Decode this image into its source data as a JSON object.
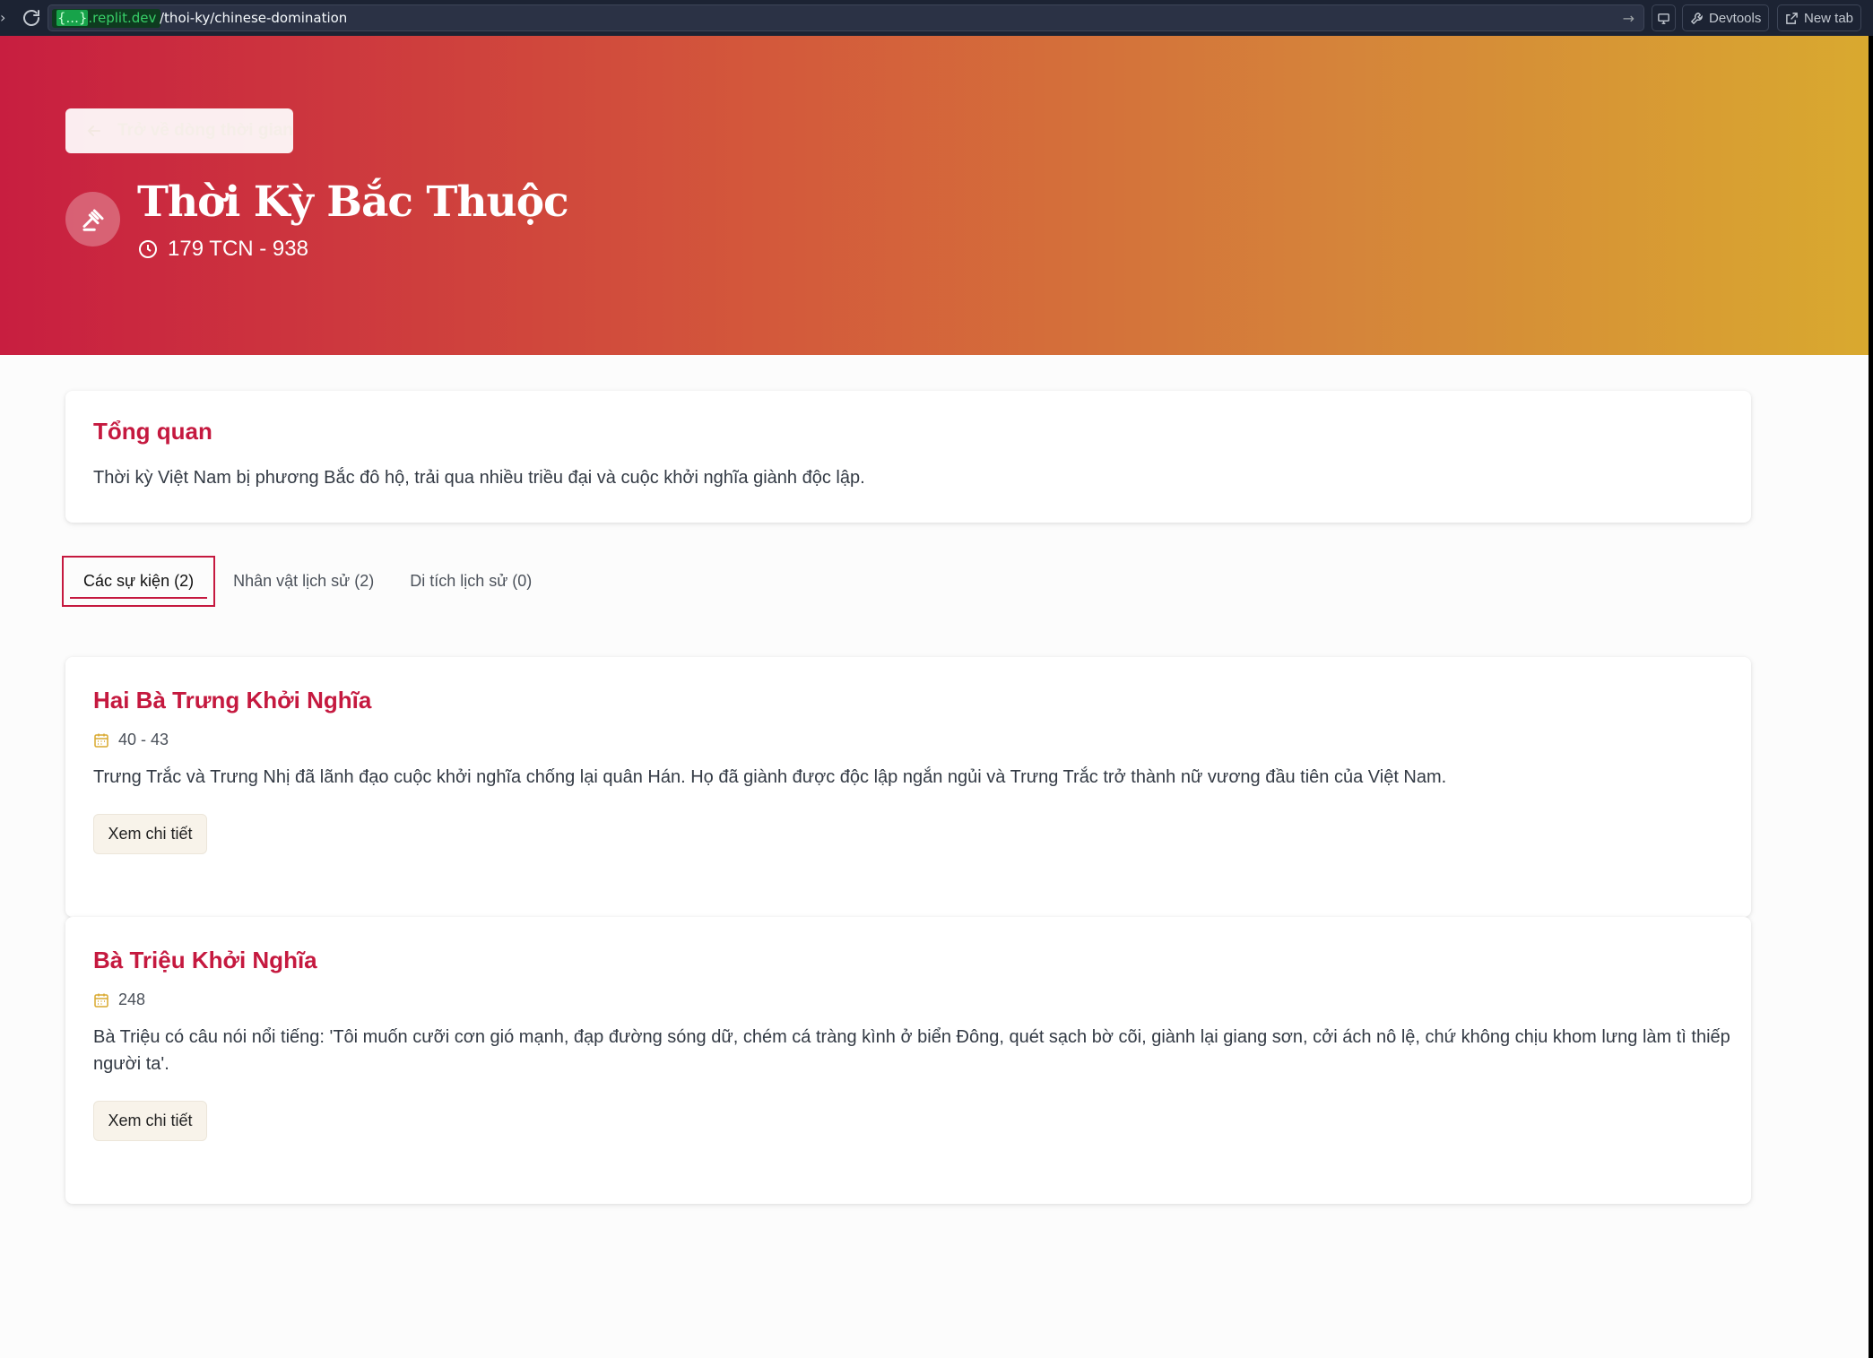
{
  "browser": {
    "domain_highlight": "{...}",
    "domain_rest": ".replit.dev",
    "path": "/thoi-ky/chinese-domination",
    "devtools_label": "Devtools",
    "newtab_label": "New tab"
  },
  "hero": {
    "back_label": "Trở về dòng thời gian",
    "title": "Thời Kỳ Bắc Thuộc",
    "date_range": "179 TCN - 938"
  },
  "overview": {
    "heading": "Tổng quan",
    "text": "Thời kỳ Việt Nam bị phương Bắc đô hộ, trải qua nhiều triều đại và cuộc khởi nghĩa giành độc lập."
  },
  "tabs": [
    {
      "label": "Các sự kiện (2)",
      "active": true
    },
    {
      "label": "Nhân vật lịch sử (2)",
      "active": false
    },
    {
      "label": "Di tích lịch sử (0)",
      "active": false
    }
  ],
  "events": [
    {
      "title": "Hai Bà Trưng Khởi Nghĩa",
      "date": "40 - 43",
      "description": "Trưng Trắc và Trưng Nhị đã lãnh đạo cuộc khởi nghĩa chống lại quân Hán. Họ đã giành được độc lập ngắn ngủi và Trưng Trắc trở thành nữ vương đầu tiên của Việt Nam.",
      "button": "Xem chi tiết"
    },
    {
      "title": "Bà Triệu Khởi Nghĩa",
      "date": "248",
      "description": "Bà Triệu có câu nói nổi tiếng: 'Tôi muốn cưỡi cơn gió mạnh, đạp đường sóng dữ, chém cá tràng kình ở biển Đông, quét sạch bờ cõi, giành lại giang sơn, cởi ách nô lệ, chứ không chịu khom lưng làm tì thiếp người ta'.",
      "button": "Xem chi tiết"
    }
  ],
  "colors": {
    "accent": "#c5193f",
    "calendar_icon": "#d9a92f"
  }
}
